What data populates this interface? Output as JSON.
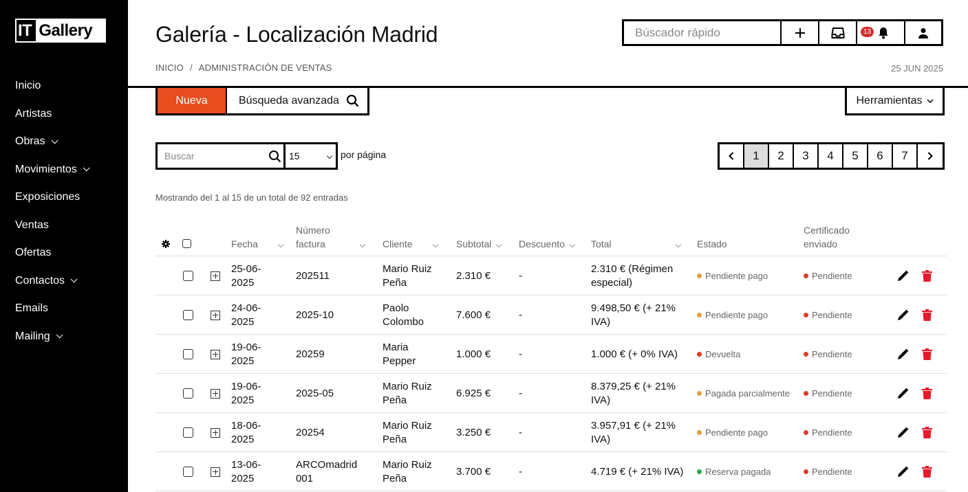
{
  "sidebar": {
    "logo_it": "IT",
    "logo_gallery": "Gallery",
    "items": [
      {
        "label": "Inicio",
        "submenu": false
      },
      {
        "label": "Artistas",
        "submenu": false
      },
      {
        "label": "Obras",
        "submenu": true
      },
      {
        "label": "Movimientos",
        "submenu": true
      },
      {
        "label": "Exposiciones",
        "submenu": false
      },
      {
        "label": "Ventas",
        "submenu": false
      },
      {
        "label": "Ofertas",
        "submenu": false
      },
      {
        "label": "Contactos",
        "submenu": true
      },
      {
        "label": "Emails",
        "submenu": false
      },
      {
        "label": "Mailing",
        "submenu": true
      }
    ]
  },
  "header": {
    "title": "Galería - Localización Madrid",
    "breadcrumb": [
      "INICIO",
      "ADMINISTRACIÓN DE VENTAS"
    ],
    "breadcrumb_sep": "/",
    "date": "25 JUN 2025",
    "quick_search_placeholder": "Búscador rápido",
    "notification_count": "13"
  },
  "toolbar": {
    "new_label": "Nueva",
    "advanced_search_label": "Búsqueda avanzada",
    "tools_label": "Herramientas"
  },
  "list_controls": {
    "search_placeholder": "Buscar",
    "per_page_value": "15",
    "per_page_label": "por página",
    "pages": [
      "1",
      "2",
      "3",
      "4",
      "5",
      "6",
      "7"
    ],
    "active_page": "1",
    "showing_text": "Mostrando del 1 al 15 de un total de 92 entradas"
  },
  "colors": {
    "accent": "#e84c1f",
    "status_orange": "#e0a040",
    "status_red": "#e03b24",
    "status_green": "#2aa84a",
    "delete_red": "#e8192c"
  },
  "table": {
    "headers": {
      "fecha": "Fecha",
      "numero_factura": "Número factura",
      "cliente": "Cliente",
      "subtotal": "Subtotal",
      "descuento": "Descuento",
      "total": "Total",
      "estado": "Estado",
      "certificado": "Certificado enviado"
    },
    "rows": [
      {
        "fecha": "25-06-2025",
        "factura": "202511",
        "cliente": "Mario Ruiz Peña",
        "subtotal": "2.310 €",
        "descuento": "-",
        "total": "2.310 € (Régimen especial)",
        "estado": "Pendiente pago",
        "estado_color": "#e0a040",
        "certificado": "Pendiente"
      },
      {
        "fecha": "24-06-2025",
        "factura": "2025-10",
        "cliente": "Paolo Colombo",
        "subtotal": "7.600 €",
        "descuento": "-",
        "total": "9.498,50 € (+ 21% IVA)",
        "estado": "Pendiente pago",
        "estado_color": "#e0a040",
        "certificado": "Pendiente"
      },
      {
        "fecha": "19-06-2025",
        "factura": "20259",
        "cliente": "Maria Pepper",
        "subtotal": "1.000 €",
        "descuento": "-",
        "total": "1.000 € (+ 0% IVA)",
        "estado": "Devuelta",
        "estado_color": "#e03b24",
        "certificado": "Pendiente"
      },
      {
        "fecha": "19-06-2025",
        "factura": "2025-05",
        "cliente": "Mario Ruiz Peña",
        "subtotal": "6.925 €",
        "descuento": "-",
        "total": "8.379,25 € (+ 21% IVA)",
        "estado": "Pagada parcialmente",
        "estado_color": "#e0a040",
        "certificado": "Pendiente"
      },
      {
        "fecha": "18-06-2025",
        "factura": "20254",
        "cliente": "Mario Ruiz Peña",
        "subtotal": "3.250 €",
        "descuento": "-",
        "total": "3.957,91 € (+ 21% IVA)",
        "estado": "Pendiente pago",
        "estado_color": "#e0a040",
        "certificado": "Pendiente"
      },
      {
        "fecha": "13-06-2025",
        "factura": "ARCOmadrid 001",
        "cliente": "Mario Ruiz Peña",
        "subtotal": "3.700 €",
        "descuento": "-",
        "total": "4.719 € (+ 21% IVA)",
        "estado": "Reserva pagada",
        "estado_color": "#2aa84a",
        "certificado": "Pendiente"
      }
    ]
  }
}
